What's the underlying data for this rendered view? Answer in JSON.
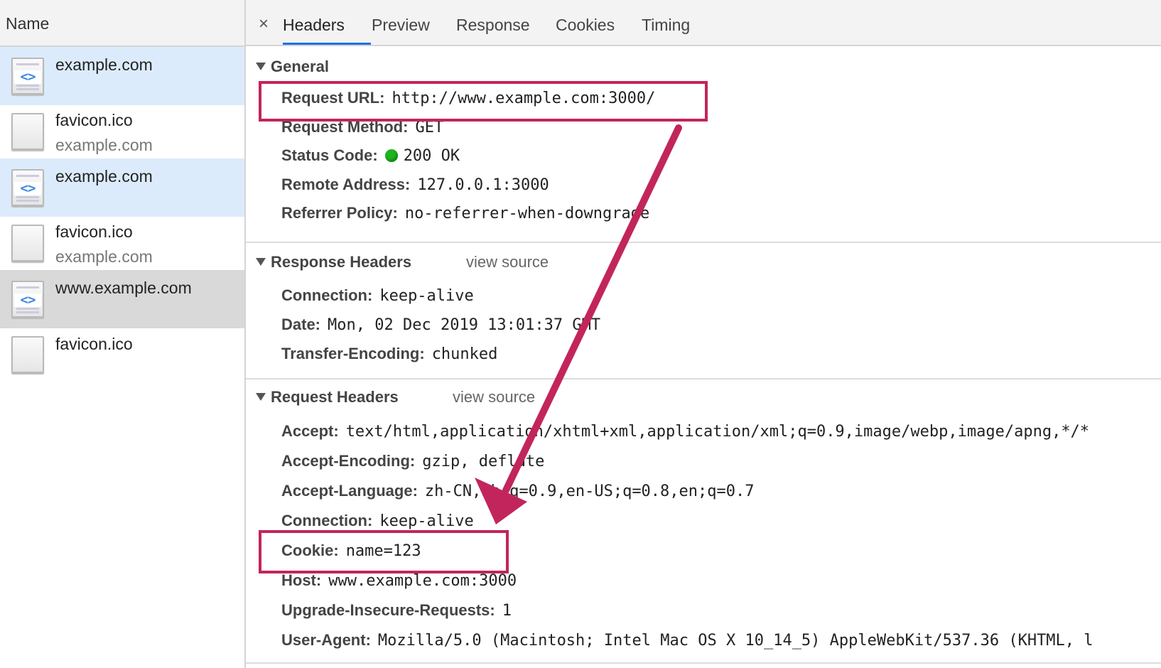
{
  "left_panel": {
    "header": "Name",
    "requests": [
      {
        "name": "example.com",
        "sub": "",
        "icon": "html-document-icon",
        "glyph": "<>"
      },
      {
        "name": "favicon.ico",
        "sub": "example.com",
        "icon": "blank-file-icon"
      },
      {
        "name": "example.com",
        "sub": "",
        "icon": "html-document-icon",
        "glyph": "<>"
      },
      {
        "name": "favicon.ico",
        "sub": "example.com",
        "icon": "blank-file-icon"
      },
      {
        "name": "www.example.com",
        "sub": "",
        "icon": "html-document-icon",
        "glyph": "<>"
      },
      {
        "name": "favicon.ico",
        "sub": "",
        "icon": "blank-file-icon"
      }
    ]
  },
  "tabs": {
    "close": "×",
    "items": [
      "Headers",
      "Preview",
      "Response",
      "Cookies",
      "Timing"
    ],
    "active": "Headers"
  },
  "general": {
    "title": "General",
    "rows": [
      {
        "key": "Request URL:",
        "value": "http://www.example.com:3000/"
      },
      {
        "key": "Request Method:",
        "value": "GET"
      },
      {
        "key": "Status Code:",
        "value": "200 OK"
      },
      {
        "key": "Remote Address:",
        "value": "127.0.0.1:3000"
      },
      {
        "key": "Referrer Policy:",
        "value": "no-referrer-when-downgrade"
      }
    ]
  },
  "response_headers": {
    "title": "Response Headers",
    "view_source": "view source",
    "rows": [
      {
        "key": "Connection:",
        "value": "keep-alive"
      },
      {
        "key": "Date:",
        "value": "Mon, 02 Dec 2019 13:01:37 GMT"
      },
      {
        "key": "Transfer-Encoding:",
        "value": "chunked"
      }
    ]
  },
  "request_headers": {
    "title": "Request Headers",
    "view_source": "view source",
    "rows": [
      {
        "key": "Accept:",
        "value": "text/html,application/xhtml+xml,application/xml;q=0.9,image/webp,image/apng,*/*"
      },
      {
        "key": "Accept-Encoding:",
        "value": "gzip, deflate"
      },
      {
        "key": "Accept-Language:",
        "value": "zh-CN,zh;q=0.9,en-US;q=0.8,en;q=0.7"
      },
      {
        "key": "Connection:",
        "value": "keep-alive"
      },
      {
        "key": "Cookie:",
        "value": "name=123"
      },
      {
        "key": "Host:",
        "value": "www.example.com:3000"
      },
      {
        "key": "Upgrade-Insecure-Requests:",
        "value": "1"
      },
      {
        "key": "User-Agent:",
        "value": "Mozilla/5.0 (Macintosh; Intel Mac OS X 10_14_5) AppleWebKit/537.36 (KHTML, l"
      }
    ]
  },
  "colors": {
    "annotation": "#c2255c",
    "status_ok": "#1fb31f",
    "tab_underline": "#1a73e8",
    "selected_row": "#dcebfc"
  }
}
